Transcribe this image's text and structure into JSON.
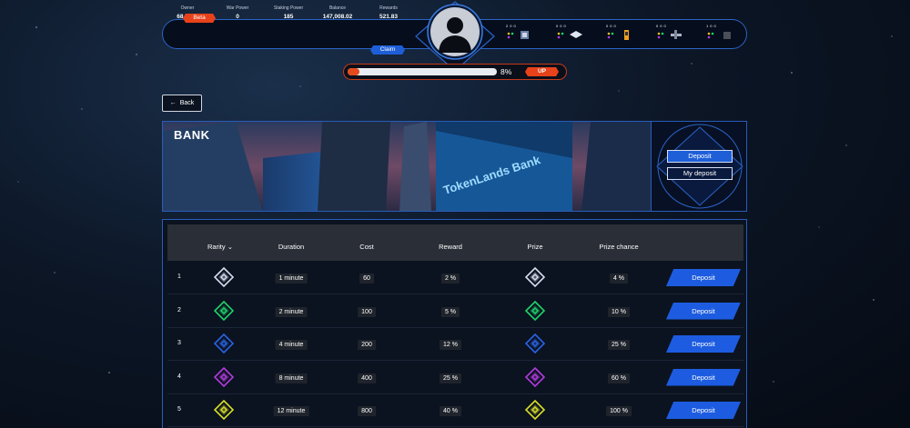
{
  "badges": {
    "beta": "Beta",
    "claim": "Claim",
    "up": "UP"
  },
  "stats": [
    {
      "label": "Owner",
      "value": "68 / 250"
    },
    {
      "label": "War Power",
      "value": "0"
    },
    {
      "label": "Staking Power",
      "value": "185"
    },
    {
      "label": "Balance",
      "value": "147,008.02"
    },
    {
      "label": "Rewards",
      "value": "521.83"
    }
  ],
  "resources": [
    {
      "counts": [
        "2",
        "0",
        "0"
      ],
      "icon": "chip-icon"
    },
    {
      "counts": [
        "0",
        "0",
        "0"
      ],
      "icon": "box-icon"
    },
    {
      "counts": [
        "0",
        "0",
        "0"
      ],
      "icon": "battery-icon"
    },
    {
      "counts": [
        "0",
        "0",
        "0"
      ],
      "icon": "tools-icon"
    },
    {
      "counts": [
        "1",
        "0",
        "0"
      ],
      "icon": "cube-icon"
    }
  ],
  "progress": {
    "percent_label": "8%",
    "value": 0.08
  },
  "back_label": "Back",
  "banner": {
    "title": "BANK",
    "deposit_label": "Deposit",
    "my_deposit_label": "My deposit"
  },
  "table": {
    "headers": [
      "Rarity",
      "Duration",
      "Cost",
      "Reward",
      "Prize",
      "Prize chance"
    ],
    "rows": [
      {
        "n": "1",
        "duration": "1 minute",
        "cost": "60",
        "reward": "2 %",
        "chance": "4 %",
        "color": "#d8ddf0",
        "action": "Deposit"
      },
      {
        "n": "2",
        "duration": "2 minute",
        "cost": "100",
        "reward": "5 %",
        "chance": "10 %",
        "color": "#1fd46a",
        "action": "Deposit"
      },
      {
        "n": "3",
        "duration": "4 minute",
        "cost": "200",
        "reward": "12 %",
        "chance": "25 %",
        "color": "#2a63e8",
        "action": "Deposit"
      },
      {
        "n": "4",
        "duration": "8 minute",
        "cost": "400",
        "reward": "25 %",
        "chance": "60 %",
        "color": "#b43ae0",
        "action": "Deposit"
      },
      {
        "n": "5",
        "duration": "12 minute",
        "cost": "800",
        "reward": "40 %",
        "chance": "100 %",
        "color": "#d9e028",
        "action": "Deposit"
      }
    ]
  }
}
